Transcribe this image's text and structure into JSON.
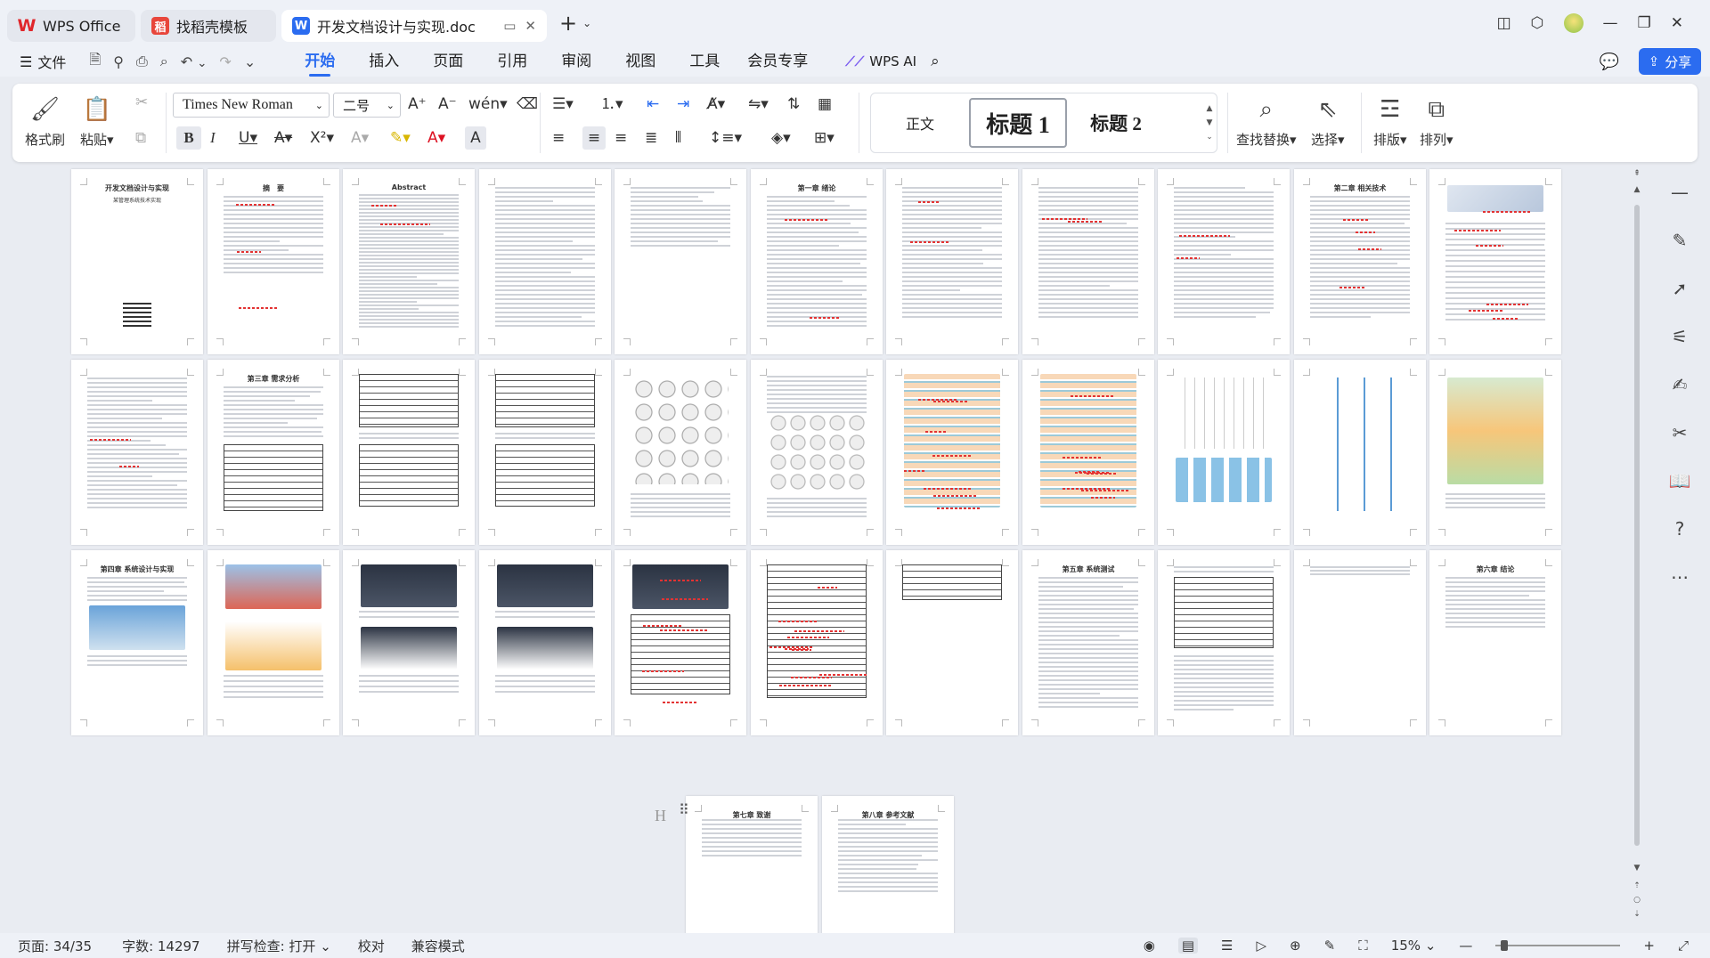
{
  "tabs": [
    {
      "label": "WPS Office"
    },
    {
      "label": "找稻壳模板"
    },
    {
      "label": "开发文档设计与实现.doc"
    }
  ],
  "menu": {
    "file": "文件",
    "items": [
      "开始",
      "插入",
      "页面",
      "引用",
      "审阅",
      "视图",
      "工具",
      "会员专享"
    ],
    "active": "开始",
    "wps_ai": "WPS AI",
    "share": "分享"
  },
  "ribbon": {
    "format_painter": "格式刷",
    "paste": "粘贴",
    "font_name": "Times New Roman",
    "font_size": "二号",
    "styles": [
      "正文",
      "标题 1",
      "标题 2"
    ],
    "find_replace": "查找替换",
    "select": "选择",
    "layout": "排版",
    "arrange": "排列"
  },
  "document": {
    "cover_title": "开发文档设计与实现",
    "cover_subtitle": "某管理系统技术实现",
    "thumb_titles": [
      "摘　要",
      "Abstract",
      "第一章 绪论",
      "第二章 相关技术",
      "第三章 需求分析",
      "第四章 系统设计与实现",
      "第五章 系统测试",
      "第六章 结论",
      "第七章 致谢",
      "第八章 参考文献"
    ],
    "cursor_hint": "H"
  },
  "status": {
    "page": "页面: 34/35",
    "words": "字数: 14297",
    "spell": "拼写检查: 打开",
    "proof": "校对",
    "compat": "兼容模式",
    "zoom": "15%"
  },
  "colors": {
    "accent": "#2b6cf0",
    "spell_error": "#e33333"
  }
}
